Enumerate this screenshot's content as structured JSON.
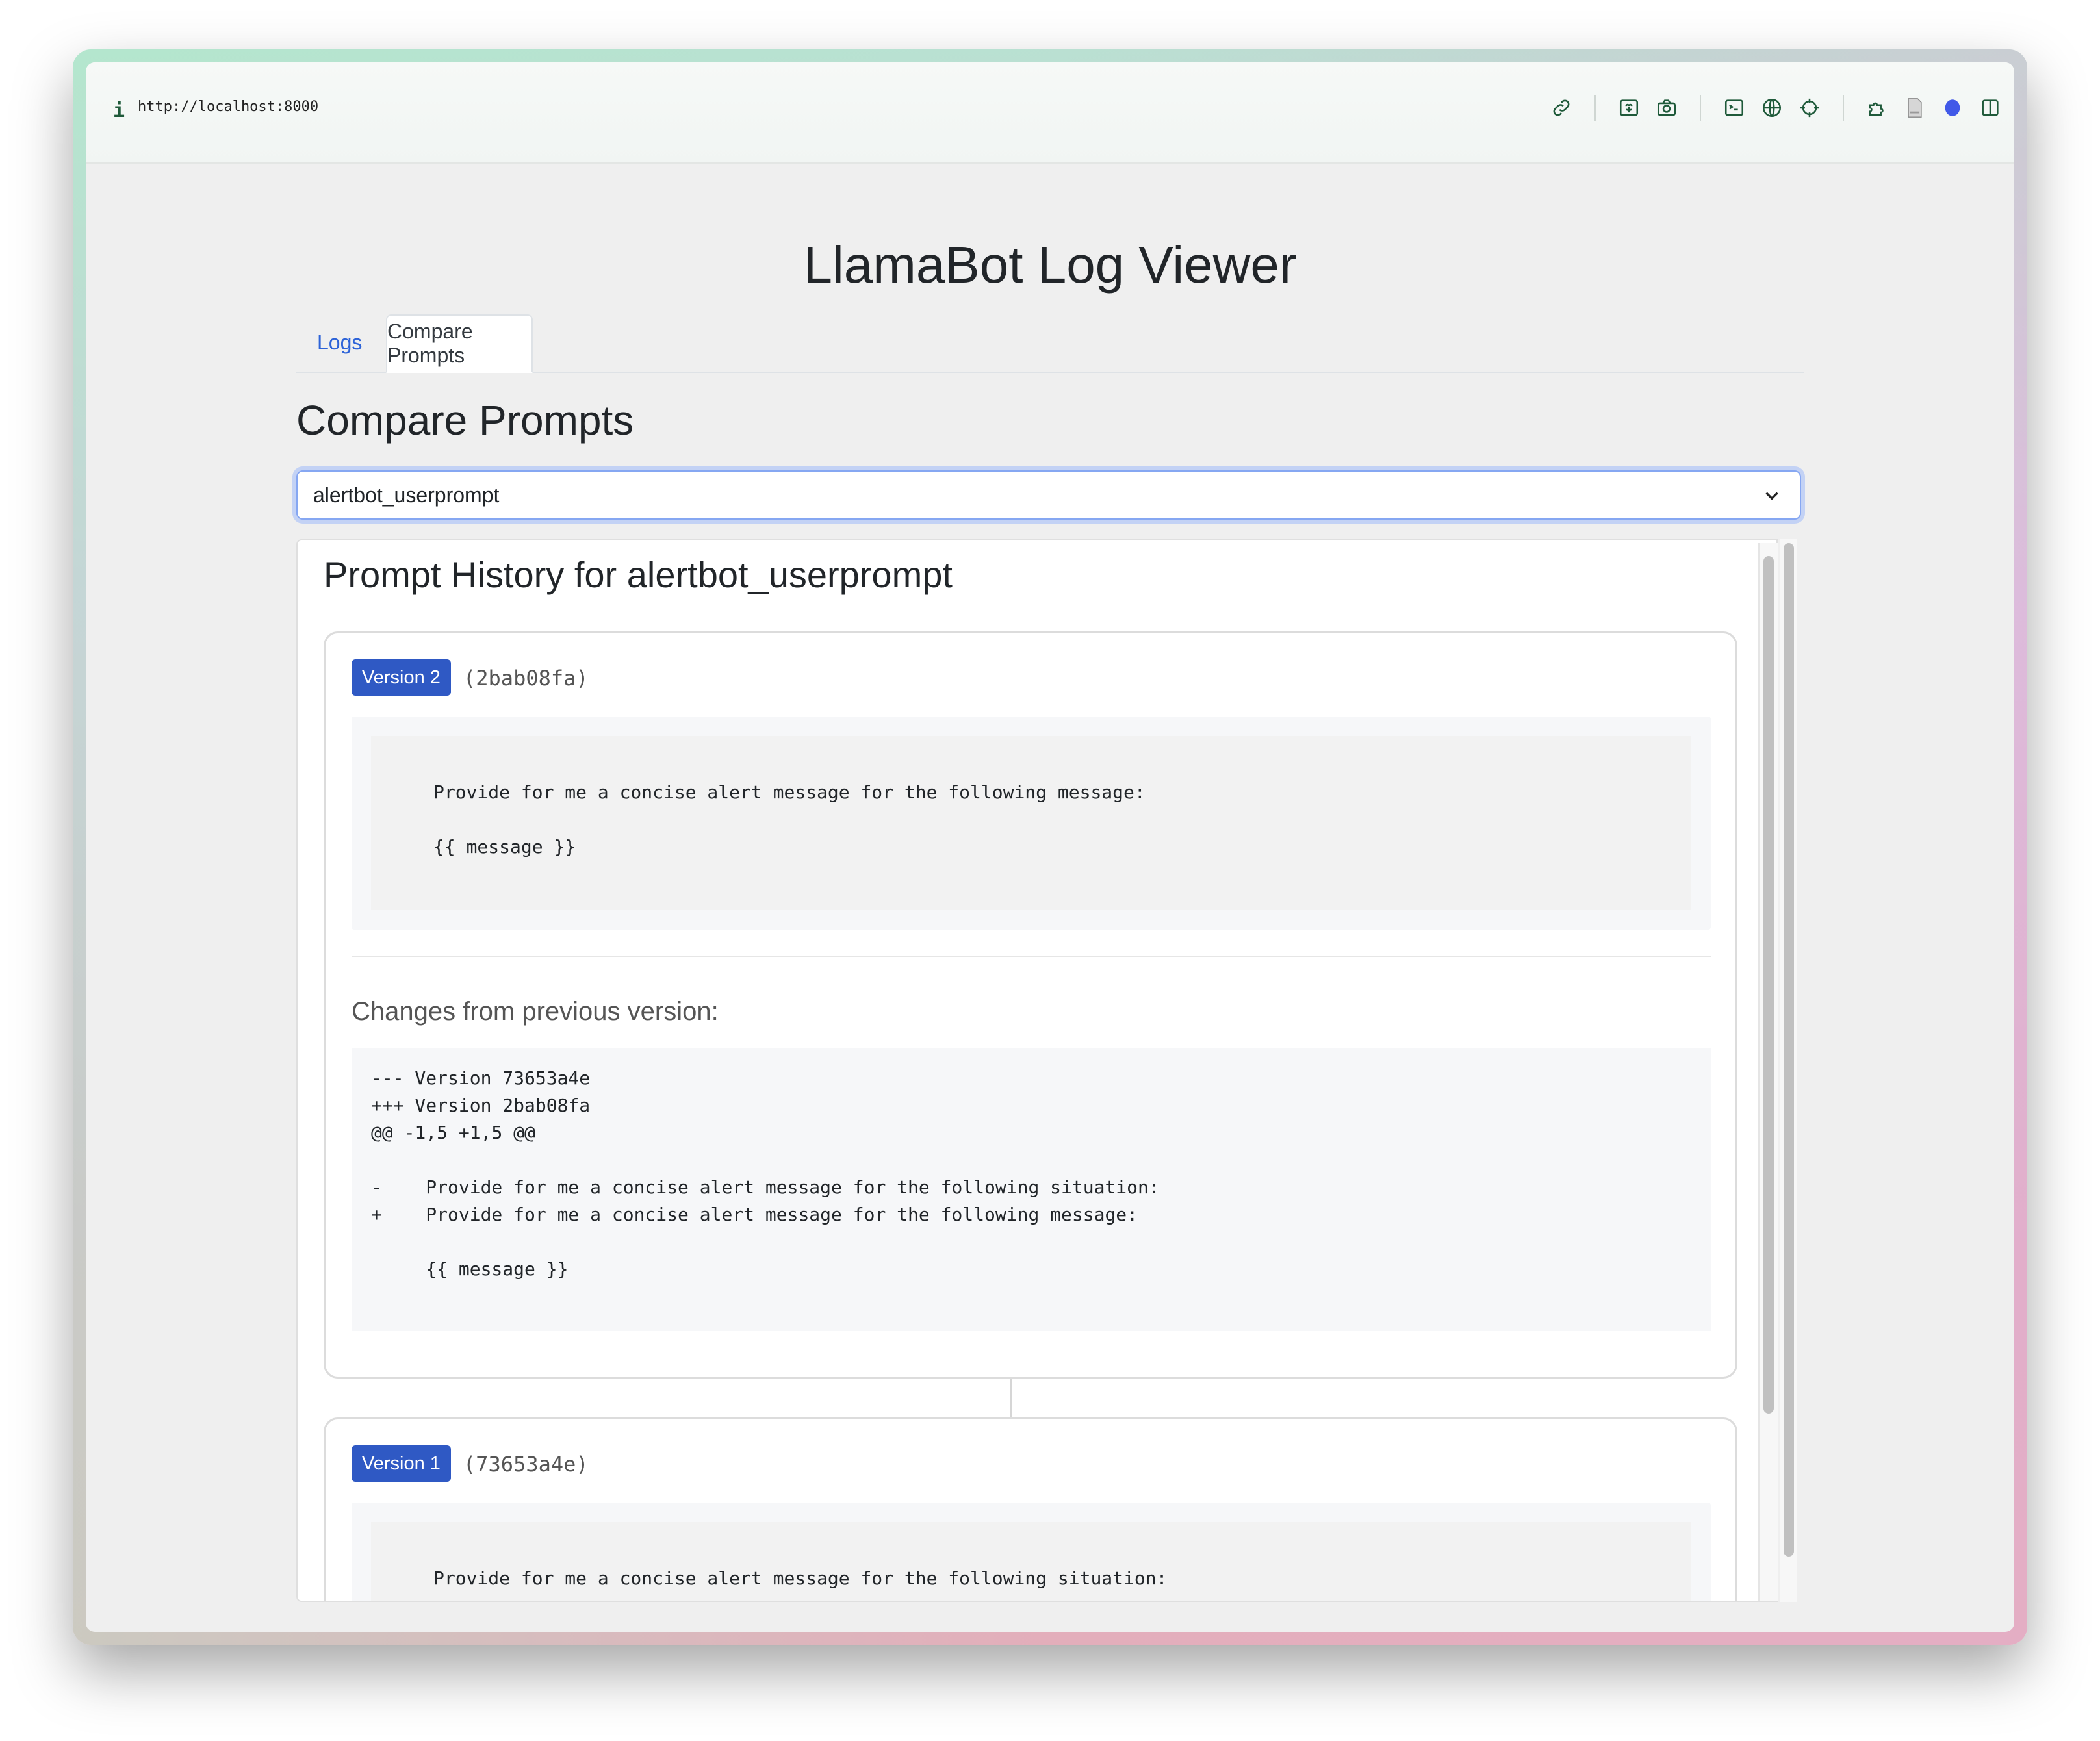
{
  "browser": {
    "url": "http://localhost:8000",
    "toolbar_icons": [
      "link-icon",
      "image-icon",
      "camera-icon",
      "terminal-icon",
      "globe-icon",
      "crosshair-icon",
      "puzzle-icon",
      "document-icon",
      "profile-dot-icon",
      "sidebar-icon"
    ],
    "accent_dot_color": "#4159e8"
  },
  "app": {
    "title": "LlamaBot Log Viewer",
    "tabs": [
      {
        "label": "Logs",
        "active": false
      },
      {
        "label": "Compare Prompts",
        "active": true
      }
    ],
    "section_title": "Compare Prompts",
    "prompt_select": {
      "selected": "alertbot_userprompt"
    },
    "history": {
      "title": "Prompt History for alertbot_userprompt",
      "versions": [
        {
          "badge": "Version 2",
          "hash": "(2bab08fa)",
          "prompt_lines": [
            "Provide for me a concise alert message for the following message:",
            "{{ message }}"
          ],
          "changes_title": "Changes from previous version:",
          "diff_lines": [
            "--- Version 73653a4e",
            "+++ Version 2bab08fa",
            "@@ -1,5 +1,5 @@",
            "",
            "-    Provide for me a concise alert message for the following situation:",
            "+    Provide for me a concise alert message for the following message:",
            "",
            "     {{ message }}"
          ]
        },
        {
          "badge": "Version 1",
          "hash": "(73653a4e)",
          "prompt_lines": [
            "Provide for me a concise alert message for the following situation:"
          ]
        }
      ]
    }
  },
  "colors": {
    "badge_bg": "#2f59c4",
    "link": "#2d63d8",
    "focus_ring": "#c3d2f5"
  }
}
